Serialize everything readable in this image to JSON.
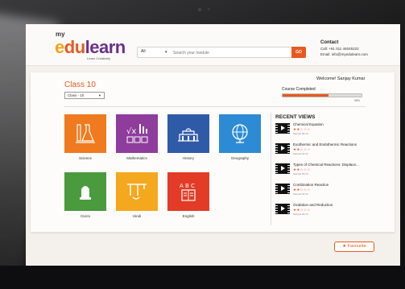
{
  "header": {
    "logo": {
      "my": "my",
      "e": "e",
      "du": "du",
      "rest": "learn",
      "tagline": "Learn Creatively"
    },
    "search": {
      "category": "All",
      "placeholder": "Search your module",
      "button": "GO"
    },
    "contact": {
      "title": "Contact",
      "call": "Call: +91 011 46045222",
      "email": "Email: info@myedulearn.com"
    }
  },
  "main": {
    "class_title": "Class 10",
    "class_select": "Class - 10",
    "welcome": "Welcome! Sanjay Kumar",
    "course_label": "Course Completed",
    "progress": 0.58,
    "progress_pct": "58%"
  },
  "subjects": [
    {
      "label": "Science",
      "color": "#f07a1e",
      "icon": "lab-flask-icon"
    },
    {
      "label": "Mathematics",
      "color": "#8e3d9c",
      "icon": "math-symbols-icon"
    },
    {
      "label": "History",
      "color": "#2f5aa8",
      "icon": "monument-icon"
    },
    {
      "label": "Geography",
      "color": "#2d8bd6",
      "icon": "globe-icon"
    },
    {
      "label": "Civics",
      "color": "#4a9a3e",
      "icon": "emblem-icon"
    },
    {
      "label": "Hindi",
      "color": "#f4a81d",
      "icon": "hindi-letters-icon"
    },
    {
      "label": "English",
      "color": "#e23c26",
      "icon": "abc-book-icon"
    }
  ],
  "recent_views": {
    "title": "RECENT VIEWS",
    "items": [
      {
        "title": "Chemical Equation",
        "stars": "★★☆☆☆",
        "meta": "Sample 00:15"
      },
      {
        "title": "Exothermic and Endothermic Reactions",
        "stars": "★★☆☆☆",
        "meta": "Sample 00:15"
      },
      {
        "title": "Types of Chemical Reactions: Displace...",
        "stars": "★★☆☆☆",
        "meta": "Sample 00:15"
      },
      {
        "title": "Combination Reaction",
        "stars": "★★☆☆☆",
        "meta": "Sample 00:15"
      },
      {
        "title": "Oxidation and Reduction",
        "stars": "★★☆☆☆",
        "meta": "Sample 00:15"
      }
    ]
  },
  "favourite": {
    "star": "★",
    "label": "Favourite"
  }
}
